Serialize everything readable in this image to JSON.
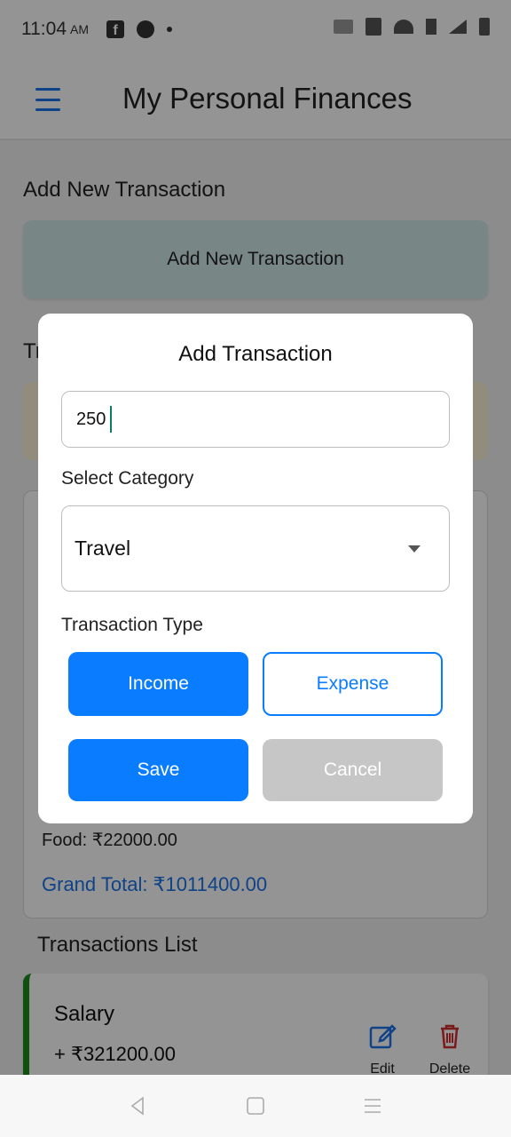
{
  "status_bar": {
    "time": "11:04",
    "ampm": "AM",
    "fb_glyph": "f"
  },
  "app_bar": {
    "title": "My Personal Finances"
  },
  "main": {
    "add_section_title": "Add New Transaction",
    "add_button_label": "Add New Transaction",
    "summary_section_title_partial": "Tr",
    "food_line": "Food: ₹22000.00",
    "grand_total": "Grand Total: ₹1011400.00",
    "transactions_list_title": "Transactions List",
    "transactions": [
      {
        "name": "Salary",
        "amount": "+ ₹321200.00",
        "edit_label": "Edit",
        "delete_label": "Delete",
        "accent_color": "#1d8a1d"
      }
    ]
  },
  "dialog": {
    "title": "Add Transaction",
    "amount_value": "250",
    "category_label": "Select Category",
    "category_value": "Travel",
    "type_label": "Transaction Type",
    "income_label": "Income",
    "expense_label": "Expense",
    "save_label": "Save",
    "cancel_label": "Cancel"
  },
  "colors": {
    "primary": "#0a7cff",
    "link_blue": "#1a73e8",
    "delete_red": "#d32f2f",
    "cancel_gray": "#c6c6c6"
  }
}
